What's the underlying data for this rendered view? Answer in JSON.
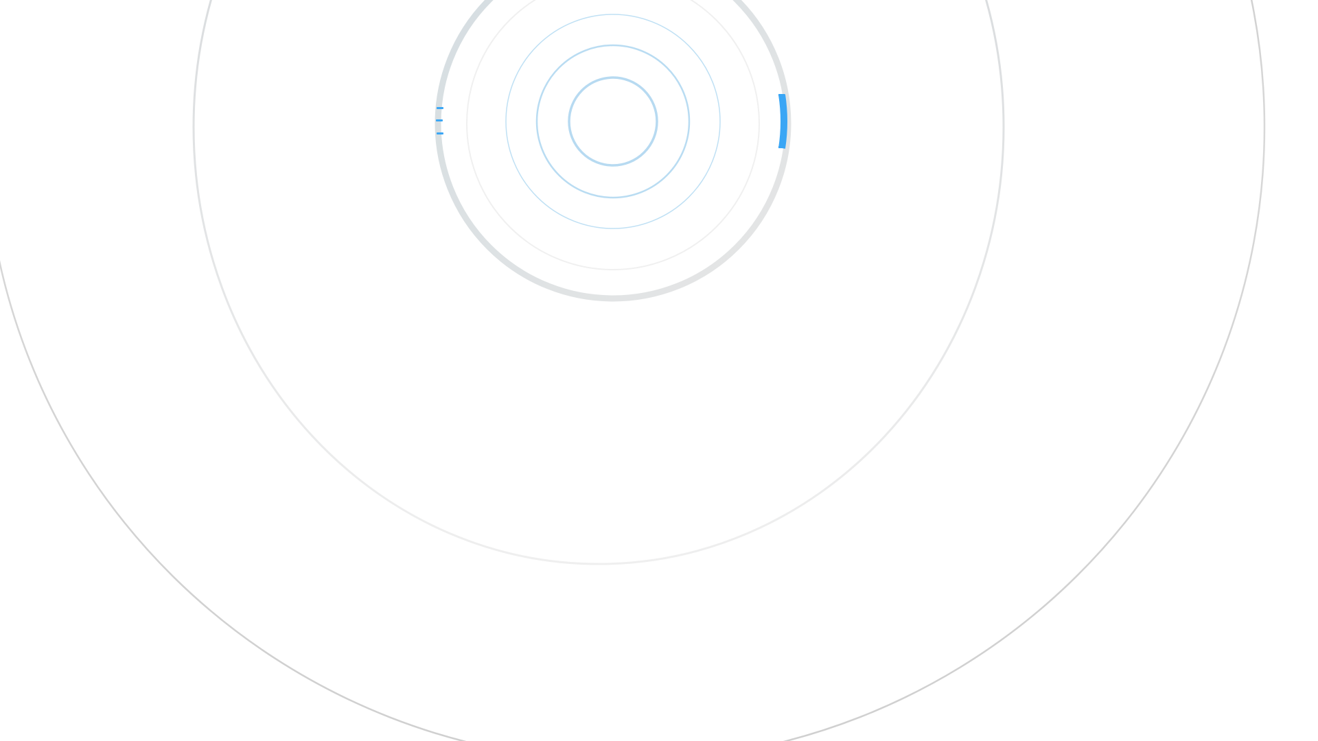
{
  "colors": {
    "background": "#ffffff",
    "accent": "#3aa6f5",
    "ring_blue": "#b9dcf2",
    "ring_gray": "#e6e6e6",
    "ring_dark_gray": "#c4c4c4"
  },
  "icons": {
    "indicator": "dash-marks-icon"
  }
}
